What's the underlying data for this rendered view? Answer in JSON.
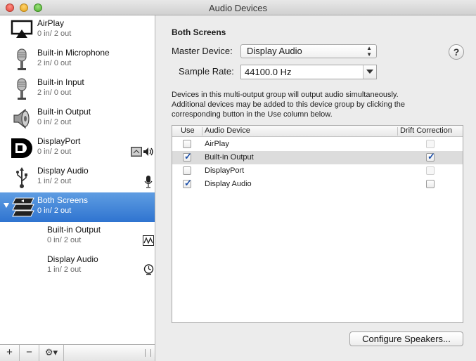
{
  "window": {
    "title": "Audio Devices"
  },
  "sidebar": {
    "devices": [
      {
        "name": "AirPlay",
        "io": "0 in/ 2 out",
        "icon": "airplay-icon"
      },
      {
        "name": "Built-in Microphone",
        "io": "2 in/ 0 out",
        "icon": "microphone-icon"
      },
      {
        "name": "Built-in Input",
        "io": "2 in/ 0 out",
        "icon": "microphone-icon"
      },
      {
        "name": "Built-in Output",
        "io": "0 in/ 2 out",
        "icon": "speaker-icon"
      },
      {
        "name": "DisplayPort",
        "io": "0 in/ 2 out",
        "icon": "displayport-icon",
        "status_icons": [
          "finder-icon",
          "volume-icon"
        ]
      },
      {
        "name": "Display Audio",
        "io": "1 in/ 2 out",
        "icon": "usb-icon",
        "status_icons": [
          "microphone-icon"
        ]
      },
      {
        "name": "Both Screens",
        "io": "0 in/ 2 out",
        "icon": "multi-output-icon",
        "selected": true,
        "expanded": true
      },
      {
        "name": "Built-in Output",
        "io": "0 in/ 2 out",
        "sub": true,
        "status_icons": [
          "waveform-icon"
        ]
      },
      {
        "name": "Display Audio",
        "io": "1 in/ 2 out",
        "sub": true,
        "status_icons": [
          "clock-icon"
        ]
      }
    ],
    "toolbar": {
      "add": "+",
      "remove": "−",
      "gear": "⚙▾"
    }
  },
  "main": {
    "heading": "Both Screens",
    "master_label": "Master Device:",
    "master_value": "Display Audio",
    "rate_label": "Sample Rate:",
    "rate_value": "44100.0 Hz",
    "help": "?",
    "description": [
      "Devices in this multi-output group will output audio simultaneously.",
      "Additional devices may be added to this device group by clicking the",
      "corresponding button in the Use column below."
    ],
    "table": {
      "headers": {
        "use": "Use",
        "device": "Audio Device",
        "drift": "Drift Correction"
      },
      "rows": [
        {
          "use": false,
          "device": "AirPlay",
          "drift": false,
          "drift_enabled": false,
          "highlight": false
        },
        {
          "use": true,
          "device": "Built-in Output",
          "drift": true,
          "drift_enabled": true,
          "highlight": true
        },
        {
          "use": false,
          "device": "DisplayPort",
          "drift": false,
          "drift_enabled": false,
          "highlight": false
        },
        {
          "use": true,
          "device": "Display Audio",
          "drift": false,
          "drift_enabled": true,
          "highlight": false
        }
      ]
    },
    "configure_button": "Configure Speakers..."
  },
  "colors": {
    "selection": "#2f74d0",
    "check": "#1c4fa8"
  }
}
